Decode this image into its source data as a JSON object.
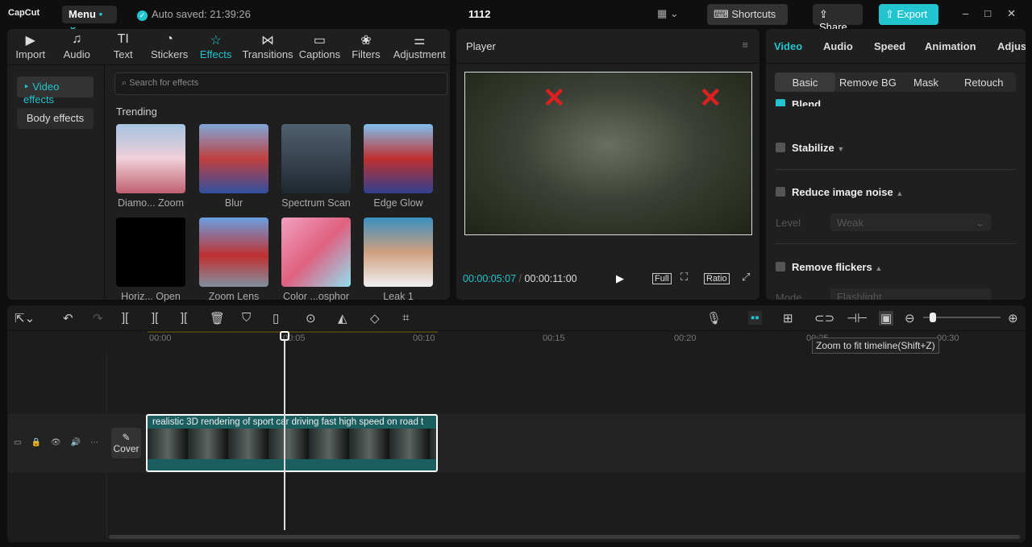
{
  "app": {
    "logo": "CapCut",
    "menu": "Menu",
    "autosave": "Auto saved: 21:39:26",
    "title": "1112",
    "shortcuts": "Shortcuts",
    "share": "Share",
    "export": "Export"
  },
  "toolbar": [
    {
      "label": "Import",
      "icon": "▶"
    },
    {
      "label": "Audio",
      "icon": "♫"
    },
    {
      "label": "Text",
      "icon": "TI"
    },
    {
      "label": "Stickers",
      "icon": "◔"
    },
    {
      "label": "Effects",
      "icon": "☆"
    },
    {
      "label": "Transitions",
      "icon": "⋈"
    },
    {
      "label": "Captions",
      "icon": "▭"
    },
    {
      "label": "Filters",
      "icon": "❀"
    },
    {
      "label": "Adjustment",
      "icon": "⚌"
    }
  ],
  "effects": {
    "categories": [
      "Video effects",
      "Body effects"
    ],
    "search_placeholder": "Search for effects",
    "section": "Trending",
    "items": [
      "Diamo... Zoom",
      "Blur",
      "Spectrum Scan",
      "Edge Glow",
      "Horiz... Open",
      "Zoom Lens",
      "Color ...osphor",
      "Leak 1"
    ]
  },
  "player": {
    "title": "Player",
    "current": "00:00:05:07",
    "total": "00:00:11:00",
    "full": "Full",
    "ratio": "Ratio"
  },
  "inspector": {
    "tabs": [
      "Video",
      "Audio",
      "Speed",
      "Animation",
      "Adjus"
    ],
    "subtabs": [
      "Basic",
      "Remove BG",
      "Mask",
      "Retouch"
    ],
    "blend": "Blend",
    "stabilize": "Stabilize",
    "noise": "Reduce image noise",
    "level_label": "Level",
    "level_value": "Weak",
    "flickers": "Remove flickers",
    "mode_label": "Mode",
    "mode_value": "Flashlight"
  },
  "timeline": {
    "ticks": [
      "00:00",
      "00:05",
      "00:10",
      "00:15",
      "00:20",
      "00:25",
      "00:30"
    ],
    "tooltip": "Zoom to fit timeline(Shift+Z)",
    "cover": "Cover",
    "clip_title": "realistic 3D rendering of sport car driving fast high speed on road t"
  },
  "colors": {
    "accent": "#22c5cf"
  }
}
